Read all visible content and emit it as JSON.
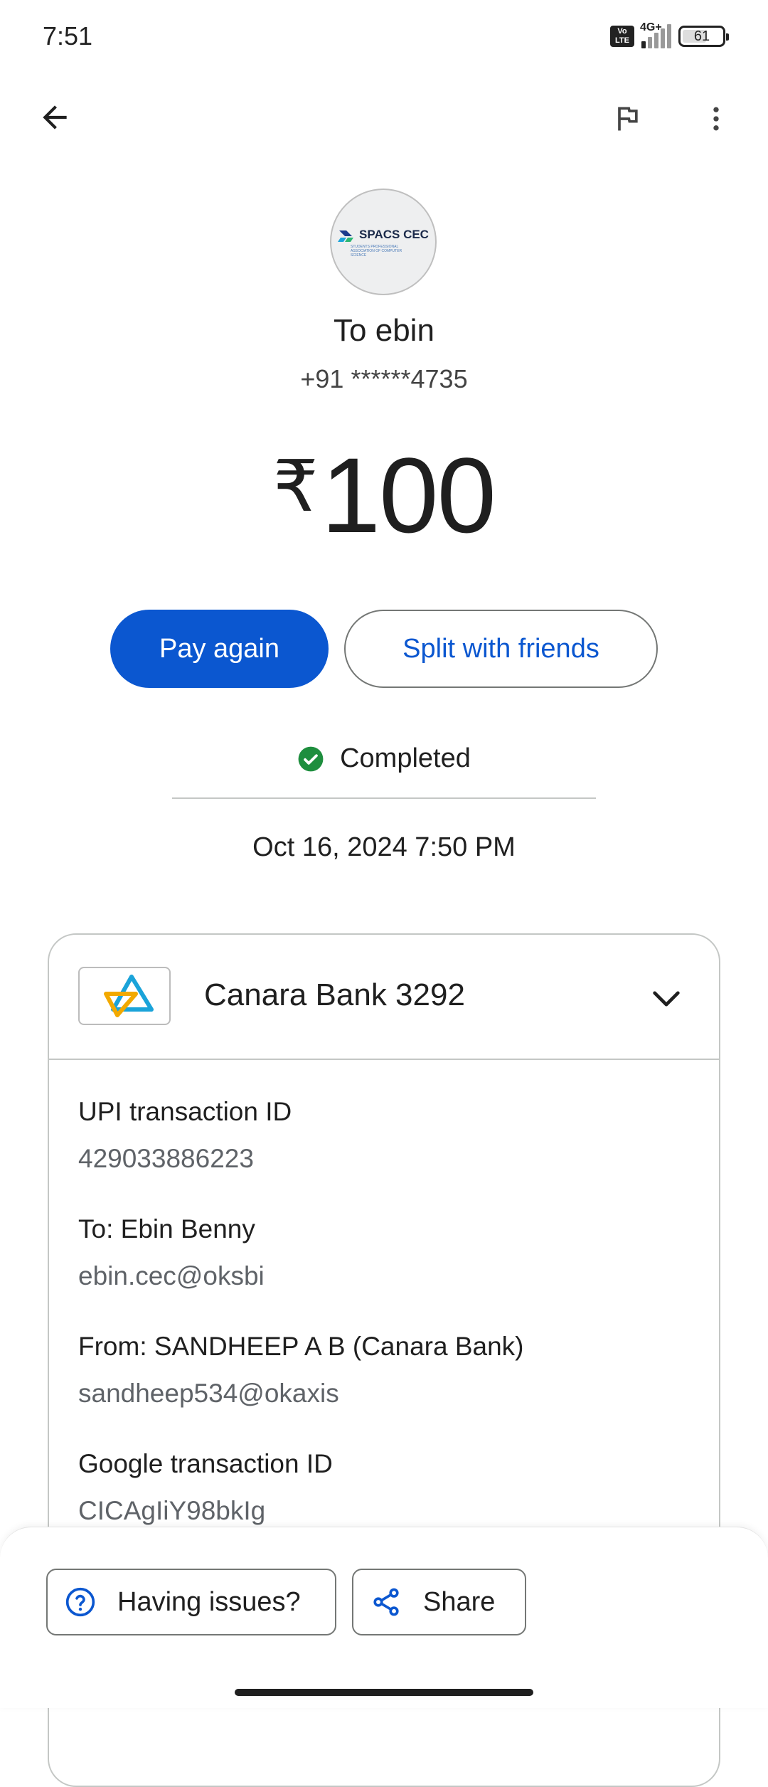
{
  "status_bar": {
    "time": "7:51",
    "volte_label": "Vo LTE",
    "network": "4G+",
    "battery": "61"
  },
  "header": {
    "back_icon": "arrow-back-icon",
    "report_icon": "flag-icon",
    "more_icon": "more-vert-icon"
  },
  "recipient": {
    "logo_text": "SPACS CEC",
    "logo_subtext": "STUDENTS PROFESSIONAL ASSOCIATION OF COMPUTER SCIENCE",
    "title": "To ebin",
    "phone": "+91 ******4735"
  },
  "amount": {
    "currency": "₹",
    "value": "100"
  },
  "actions": {
    "pay_again": "Pay again",
    "split": "Split with friends"
  },
  "status": {
    "label": "Completed",
    "color": "#1e8e3e"
  },
  "date": "Oct 16, 2024 7:50 PM",
  "details": {
    "bank_name": "Canara Bank 3292",
    "fields": [
      {
        "label": "UPI transaction ID",
        "value": "429033886223"
      },
      {
        "label": "To: Ebin  Benny",
        "value": "ebin.cec@oksbi"
      },
      {
        "label": "From: SANDHEEP A B (Canara Bank)",
        "value": "sandheep534@okaxis"
      },
      {
        "label": "Google transaction ID",
        "value": "CICAgIiY98bkIg"
      }
    ]
  },
  "bottom": {
    "issues": "Having issues?",
    "share": "Share"
  },
  "colors": {
    "accent": "#0b57d0",
    "text": "#1f1f1f",
    "secondary_text": "#5f6368"
  }
}
